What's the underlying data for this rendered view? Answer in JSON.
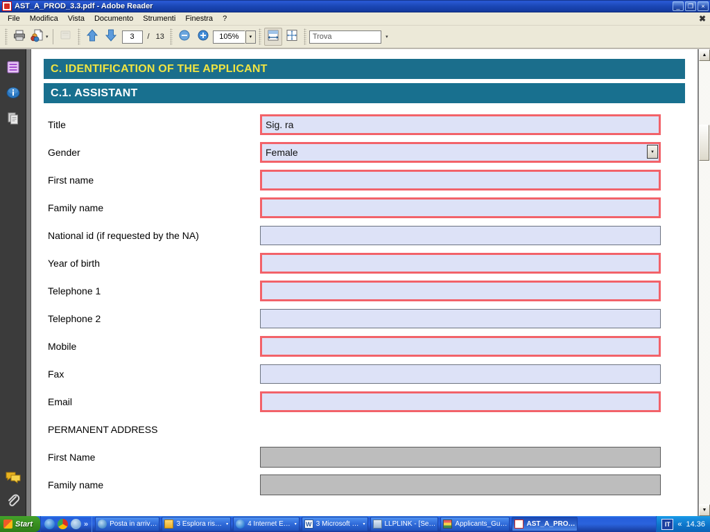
{
  "window": {
    "title": "AST_A_PROD_3.3.pdf - Adobe Reader",
    "app_icon": "pdf-icon",
    "minimize": "_",
    "restore": "❐",
    "close": "×",
    "doc_close": "✖"
  },
  "menu": {
    "items": [
      {
        "label": "File"
      },
      {
        "label": "Modifica"
      },
      {
        "label": "Vista"
      },
      {
        "label": "Documento"
      },
      {
        "label": "Strumenti"
      },
      {
        "label": "Finestra"
      },
      {
        "label": "?"
      }
    ]
  },
  "toolbar": {
    "print_icon": "printer-icon",
    "share_icon": "share-document-icon",
    "share_caret": "▾",
    "snapshot_icon": "snapshot-disabled-icon",
    "prev_page_icon": "arrow-up-icon",
    "next_page_icon": "arrow-down-icon",
    "page_current": "3",
    "page_separator": "/",
    "page_total": "13",
    "zoom_out_icon": "zoom-out-icon",
    "zoom_in_icon": "zoom-in-icon",
    "zoom_value": "105%",
    "zoom_caret": "▾",
    "fit_width_icon": "fit-width-icon",
    "fit_page_icon": "fit-page-icon",
    "find_placeholder": "Trova",
    "find_value": "",
    "find_caret": "▾"
  },
  "navpane": {
    "items": [
      {
        "name": "bookmarks-icon",
        "label": "Segnalibri"
      },
      {
        "name": "info-icon",
        "label": "Informazioni"
      },
      {
        "name": "pages-icon",
        "label": "Pagine"
      }
    ],
    "bottom_items": [
      {
        "name": "comments-icon",
        "label": "Commenti"
      },
      {
        "name": "attachments-icon",
        "label": "Allegati"
      }
    ]
  },
  "document": {
    "band_main": "C. IDENTIFICATION OF THE APPLICANT",
    "band_sub": "C.1. ASSISTANT",
    "section_label": "PERMANENT ADDRESS",
    "fields": [
      {
        "label": "Title",
        "value": "Sig. ra",
        "state": "required",
        "control": "text"
      },
      {
        "label": "Gender",
        "value": "Female",
        "state": "required",
        "control": "dropdown",
        "caret": "▾"
      },
      {
        "label": "First name",
        "value": "",
        "state": "required",
        "control": "text"
      },
      {
        "label": "Family name",
        "value": "",
        "state": "required",
        "control": "text"
      },
      {
        "label": "National id (if requested by the NA)",
        "value": "",
        "state": "optional",
        "control": "text"
      },
      {
        "label": "Year of birth",
        "value": "",
        "state": "required",
        "control": "text"
      },
      {
        "label": "Telephone 1",
        "value": "",
        "state": "required",
        "control": "text"
      },
      {
        "label": "Telephone 2",
        "value": "",
        "state": "optional",
        "control": "text"
      },
      {
        "label": "Mobile",
        "value": "",
        "state": "required",
        "control": "text"
      },
      {
        "label": "Fax",
        "value": "",
        "state": "optional",
        "control": "text"
      },
      {
        "label": "Email",
        "value": "",
        "state": "required",
        "control": "text"
      }
    ],
    "address_fields": [
      {
        "label": "First Name",
        "value": "",
        "state": "disabled",
        "control": "text"
      },
      {
        "label": "Family name",
        "value": "",
        "state": "disabled",
        "control": "text"
      }
    ]
  },
  "scrollbar": {
    "up_arrow": "▲",
    "down_arrow": "▼"
  },
  "taskbar": {
    "start_label": "Start",
    "quicklaunch": [
      {
        "name": "internet-explorer-quicklaunch-icon",
        "color": "#2e7fd4"
      },
      {
        "name": "chrome-quicklaunch-icon",
        "color": "#d93025"
      },
      {
        "name": "browser-quicklaunch-icon",
        "color": "#7aa8d8"
      }
    ],
    "quicklaunch_chevron": "»",
    "tasks": [
      {
        "label": "Posta in arriv…",
        "icon": "outlook-icon",
        "color": "#4b8ec9",
        "caret": "",
        "active": false
      },
      {
        "label": "3 Esplora ris…",
        "icon": "folder-icon",
        "color": "#f5c344",
        "caret": "▾",
        "active": false
      },
      {
        "label": "4 Internet E…",
        "icon": "internet-explorer-icon",
        "color": "#2e7fd4",
        "caret": "▾",
        "active": false
      },
      {
        "label": "3 Microsoft …",
        "icon": "word-icon",
        "color": "#2b579a",
        "caret": "▾",
        "active": false
      },
      {
        "label": "LLPLINK - [Se…",
        "icon": "terminal-icon",
        "color": "#9bb7d4",
        "caret": "",
        "active": false
      },
      {
        "label": "Applicants_Gu…",
        "icon": "book-icon",
        "color": "#3f8f4f",
        "caret": "",
        "active": false
      },
      {
        "label": "AST_A_PRO…",
        "icon": "acrobat-icon",
        "color": "#d62b1f",
        "caret": "",
        "active": true
      }
    ],
    "ime": "IT",
    "tray_chevron": "«",
    "clock": "14.36"
  },
  "colors": {
    "band_main_bg": "#1b6e8c",
    "band_main_fg": "#f0e442",
    "band_sub_bg": "#18708f",
    "band_sub_fg": "#ffffff",
    "field_bg": "#dde2f7",
    "field_required_border": "#f26269",
    "field_optional_border": "#6b7280",
    "field_disabled_bg": "#bdbdbd",
    "titlebar": "#0a246a",
    "taskbar": "#245edb",
    "start_green": "#3a9122"
  }
}
